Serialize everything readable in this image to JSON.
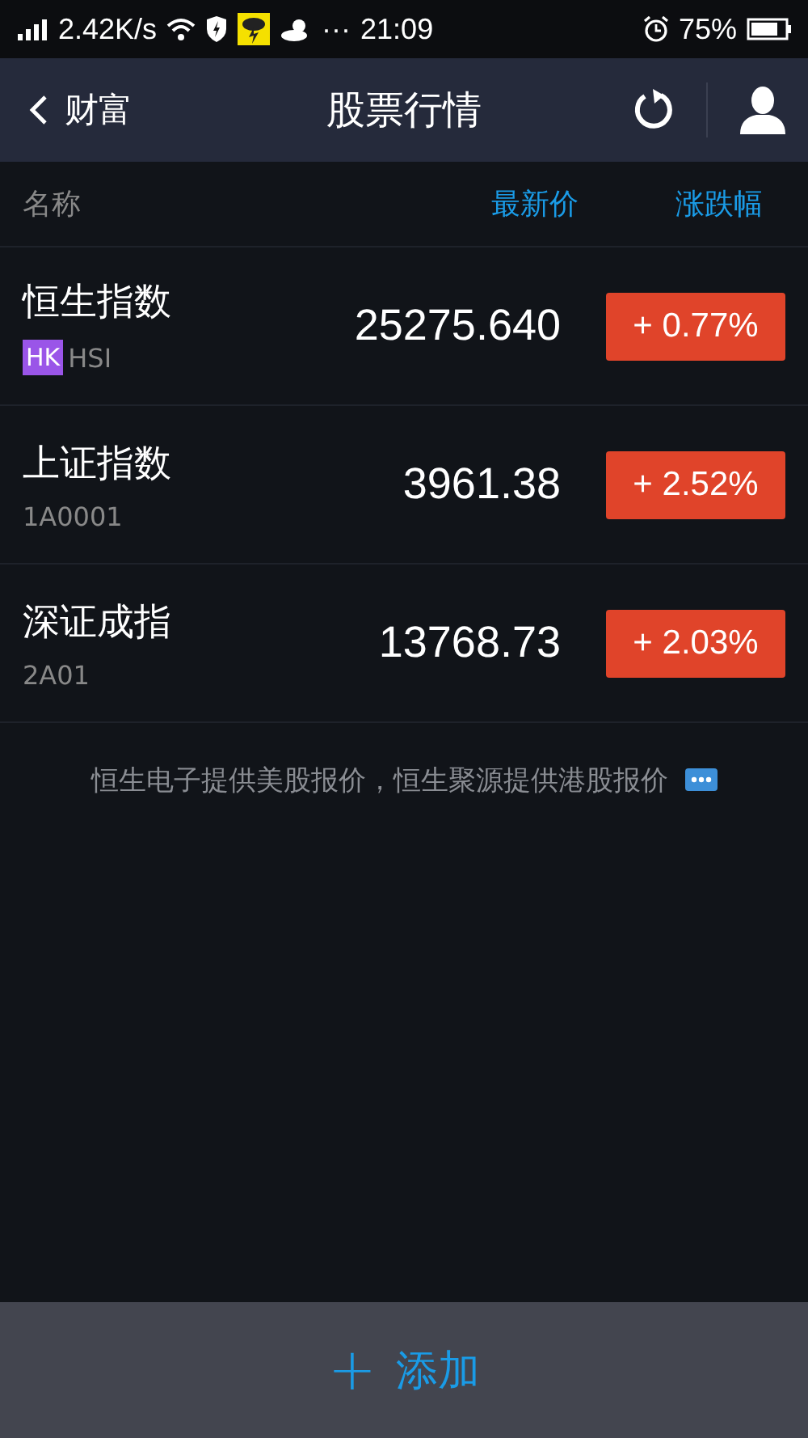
{
  "status_bar": {
    "speed": "2.42K/s",
    "dots": "···",
    "time": "21:09",
    "battery": "75%"
  },
  "nav": {
    "back_label": "财富",
    "title": "股票行情"
  },
  "table": {
    "columns": [
      "名称",
      "最新价",
      "涨跌幅"
    ],
    "rows": [
      {
        "name": "恒生指数",
        "market": "HK",
        "code": "HSI",
        "price": "25275.640",
        "change": "+ 0.77%",
        "rising": true
      },
      {
        "name": "上证指数",
        "code": "1A0001",
        "price": "3961.38",
        "change": "+ 2.52%",
        "rising": true
      },
      {
        "name": "深证成指",
        "code": "2A01",
        "price": "13768.73",
        "change": "+ 2.03%",
        "rising": true
      }
    ]
  },
  "note": "恒生电子提供美股报价，恒生聚源提供港股报价",
  "bottom": {
    "add_icon": "+",
    "add_label": "添加"
  }
}
